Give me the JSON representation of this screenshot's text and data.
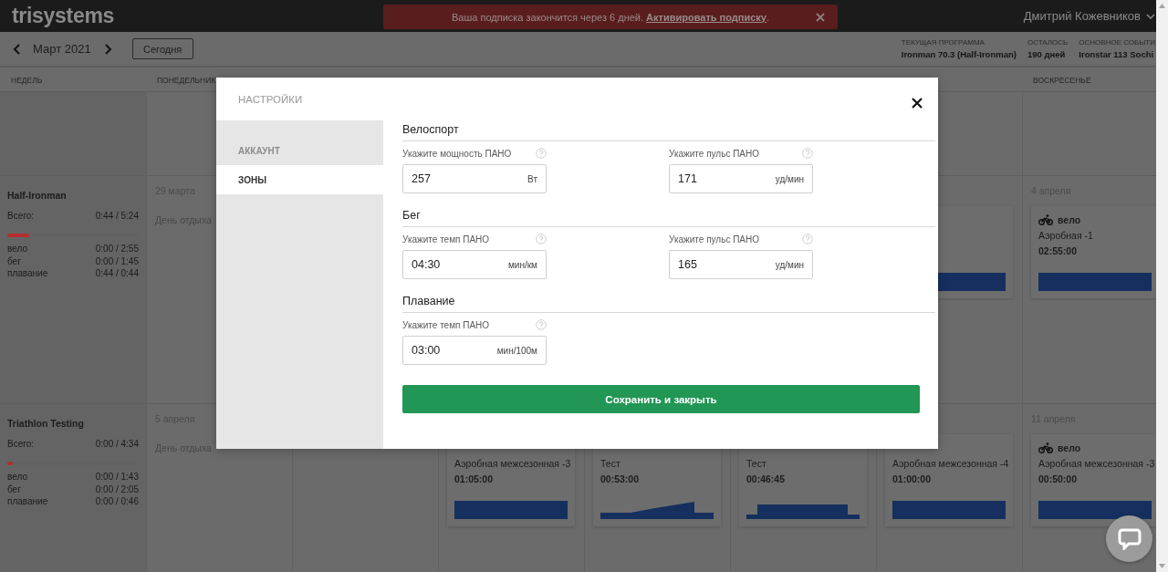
{
  "topbar": {
    "logo": "trisystems",
    "banner": {
      "message": "Ваша подписка закончится через 6 дней.",
      "link": "Активировать подписку",
      "tail": "."
    },
    "user": "Дмитрий Кожевников"
  },
  "toolbar": {
    "month": "Март 2021",
    "today": "Сегодня",
    "info": [
      {
        "label": "ТЕКУЩАЯ ПРОГРАММА",
        "value": "Ironman 70.3 (Half-Ironman)"
      },
      {
        "label": "ОСТАЛОСЬ",
        "value": "190 дней"
      },
      {
        "label": "ОСНОВНОЕ СОБЫТИ",
        "value": "Ironstar 113 Sochi"
      }
    ]
  },
  "columns": {
    "week": "НЕДЕЛЬ",
    "monday": "ПОНЕДЕЛЬНИК",
    "sunday": "ВОСКРЕСЕНЬЕ"
  },
  "weeks": [
    {
      "title": "Half-Ironman",
      "total_label": "Всего:",
      "total": "0:44 / 5:24",
      "level": 0.17,
      "sports": [
        {
          "name": "вело",
          "value": "0:00 / 2:55"
        },
        {
          "name": "бег",
          "value": "0:00 / 1:45"
        },
        {
          "name": "плавание",
          "value": "0:44 / 0:44"
        }
      ],
      "days": [
        {
          "kind": "rest",
          "date": "29 марта",
          "rest": "День отдыха"
        },
        {
          "kind": "empty"
        },
        {
          "kind": "empty"
        },
        {
          "kind": "empty"
        },
        {
          "kind": "empty"
        },
        {
          "kind": "workout",
          "card": {
            "kind": "flat"
          }
        },
        {
          "kind": "workout",
          "date": "4 апреля",
          "card": {
            "sport": "вело",
            "name": "Аэробная -1",
            "time": "02:55:00",
            "kind": "flat"
          }
        }
      ]
    },
    {
      "title": "Triathlon Testing",
      "total_label": "Всего:",
      "total": "0:00 / 4:34",
      "level": 0.04,
      "sports": [
        {
          "name": "вело",
          "value": "0:00 / 1:43"
        },
        {
          "name": "бег",
          "value": "0:00 / 2:05"
        },
        {
          "name": "плавание",
          "value": "0:00 / 0:46"
        }
      ],
      "days": [
        {
          "kind": "rest",
          "date": "5 апреля",
          "rest": "День отдыха"
        },
        {
          "kind": "empty"
        },
        {
          "kind": "workout",
          "card": {
            "name": "Аэробная межсезонная -3",
            "time": "01:05:00",
            "kind": "flat"
          }
        },
        {
          "kind": "workout",
          "card": {
            "name": "Тест",
            "time": "00:53:00",
            "kind": "ramp"
          }
        },
        {
          "kind": "workout",
          "card": {
            "name": "Тест",
            "time": "00:46:45",
            "kind": "steps"
          }
        },
        {
          "kind": "workout",
          "card": {
            "name": "Аэробная межсезонная -4",
            "time": "01:00:00",
            "kind": "flat"
          }
        },
        {
          "kind": "workout",
          "date": "11 апреля",
          "card": {
            "sport": "вело",
            "name": "Аэробная межсезонная -3",
            "time": "00:50:00",
            "kind": "flat"
          }
        }
      ]
    }
  ],
  "modal": {
    "title": "НАСТРОЙКИ",
    "nav": [
      {
        "label": "АККАУНТ",
        "selected": false
      },
      {
        "label": "ЗОНЫ",
        "selected": true
      }
    ],
    "sections": [
      {
        "title": "Велоспорт",
        "fields": [
          {
            "label": "Укажите мощность ПАНО",
            "value": "257",
            "unit": "Вт"
          },
          {
            "label": "Укажите пульс ПАНО",
            "value": "171",
            "unit": "уд/мин"
          }
        ]
      },
      {
        "title": "Бег",
        "fields": [
          {
            "label": "Укажите темп ПАНО",
            "value": "04:30",
            "unit": "мин/км"
          },
          {
            "label": "Укажите пульс ПАНО",
            "value": "165",
            "unit": "уд/мин"
          }
        ]
      },
      {
        "title": "Плавание",
        "fields": [
          {
            "label": "Укажите темп ПАНО",
            "value": "03:00",
            "unit": "мин/100м"
          }
        ]
      }
    ],
    "save": "Сохранить и закрыть"
  }
}
